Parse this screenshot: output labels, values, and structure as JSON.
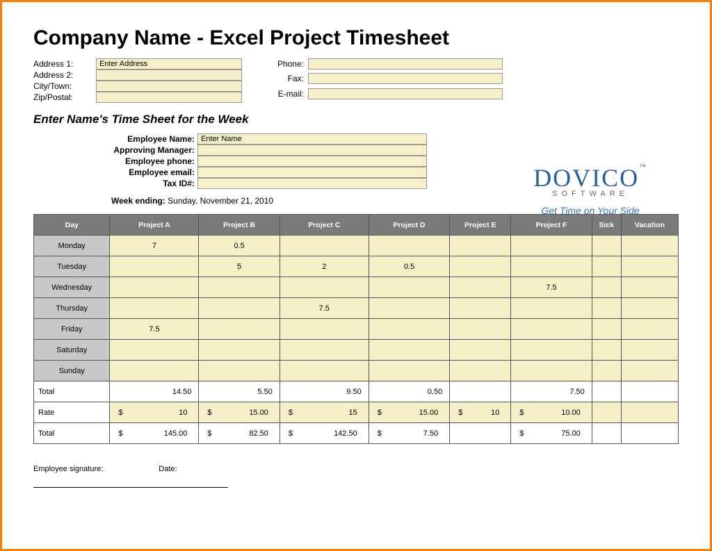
{
  "title": "Company Name - Excel Project Timesheet",
  "company": {
    "labels": {
      "addr1": "Address 1:",
      "addr2": "Address 2:",
      "city": "City/Town:",
      "zip": "Zip/Postal:",
      "phone": "Phone:",
      "fax": "Fax:",
      "email": "E-mail:"
    },
    "values": {
      "addr1": "Enter Address",
      "addr2": "",
      "city": "",
      "zip": "",
      "phone": "",
      "fax": "",
      "email": ""
    }
  },
  "subtitle": "Enter Name's Time Sheet for the Week",
  "employee": {
    "labels": {
      "name": "Employee Name:",
      "manager": "Approving Manager:",
      "phone": "Employee phone:",
      "email": "Employee email:",
      "tax": "Tax ID#:"
    },
    "values": {
      "name": "Enter Name",
      "manager": "",
      "phone": "",
      "email": "",
      "tax": ""
    }
  },
  "week_ending_label": "Week ending:",
  "week_ending_value": "Sunday, November 21, 2010",
  "logo": {
    "main": "DOVICO",
    "tm": "™",
    "sub": "SOFTWARE",
    "tag": "Get Time on Your Side"
  },
  "headers": [
    "Day",
    "Project A",
    "Project B",
    "Project C",
    "Project D",
    "Project E",
    "Project F",
    "Sick",
    "Vacation"
  ],
  "rows": [
    {
      "day": "Monday",
      "cells": [
        "7",
        "0.5",
        "",
        "",
        "",
        "",
        "",
        ""
      ]
    },
    {
      "day": "Tuesday",
      "cells": [
        "",
        "5",
        "2",
        "0.5",
        "",
        "",
        "",
        ""
      ]
    },
    {
      "day": "Wednesday",
      "cells": [
        "",
        "",
        "",
        "",
        "",
        "7.5",
        "",
        ""
      ]
    },
    {
      "day": "Thursday",
      "cells": [
        "",
        "",
        "7.5",
        "",
        "",
        "",
        "",
        ""
      ]
    },
    {
      "day": "Friday",
      "cells": [
        "7.5",
        "",
        "",
        "",
        "",
        "",
        "",
        ""
      ]
    },
    {
      "day": "Saturday",
      "cells": [
        "",
        "",
        "",
        "",
        "",
        "",
        "",
        ""
      ]
    },
    {
      "day": "Sunday",
      "cells": [
        "",
        "",
        "",
        "",
        "",
        "",
        "",
        ""
      ]
    }
  ],
  "totals_label": "Total",
  "totals": [
    "14.50",
    "5.50",
    "9.50",
    "0.50",
    "",
    "7.50",
    "",
    ""
  ],
  "rate_label": "Rate",
  "rates": [
    {
      "cur": "$",
      "amt": "10"
    },
    {
      "cur": "$",
      "amt": "15.00"
    },
    {
      "cur": "$",
      "amt": "15"
    },
    {
      "cur": "$",
      "amt": "15.00"
    },
    {
      "cur": "$",
      "amt": "10"
    },
    {
      "cur": "$",
      "amt": "10.00"
    },
    {
      "cur": "",
      "amt": ""
    },
    {
      "cur": "",
      "amt": ""
    }
  ],
  "grand_label": "Total",
  "grand": [
    {
      "cur": "$",
      "amt": "145.00"
    },
    {
      "cur": "$",
      "amt": "82.50"
    },
    {
      "cur": "$",
      "amt": "142.50"
    },
    {
      "cur": "$",
      "amt": "7.50"
    },
    {
      "cur": "",
      "amt": ""
    },
    {
      "cur": "$",
      "amt": "75.00"
    },
    {
      "cur": "",
      "amt": ""
    },
    {
      "cur": "",
      "amt": ""
    }
  ],
  "signature_label": "Employee signature:",
  "date_label": "Date:"
}
